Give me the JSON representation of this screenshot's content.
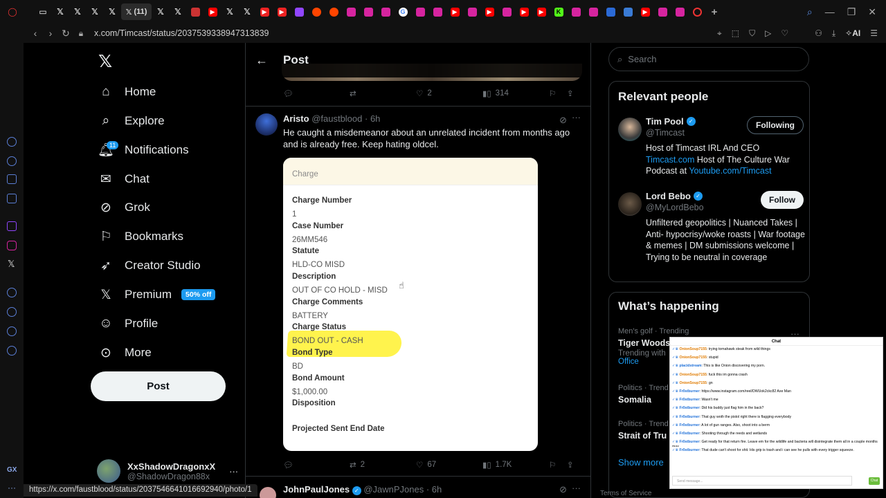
{
  "browser": {
    "active_tab_label": "(11)",
    "url": "x.com/Timcast/status/2037539338947313839",
    "ai_label": "AI",
    "status_link": "https://x.com/faustblood/status/2037546641016692940/photo/1"
  },
  "nav": {
    "items": [
      {
        "label": "Home",
        "icon": "home-icon"
      },
      {
        "label": "Explore",
        "icon": "search-icon"
      },
      {
        "label": "Notifications",
        "icon": "bell-icon",
        "badge": "11"
      },
      {
        "label": "Chat",
        "icon": "mail-icon"
      },
      {
        "label": "Grok",
        "icon": "grok-icon"
      },
      {
        "label": "Bookmarks",
        "icon": "bookmark-icon"
      },
      {
        "label": "Creator Studio",
        "icon": "rocket-icon"
      },
      {
        "label": "Premium",
        "icon": "x-logo-icon",
        "promo": "50% off"
      },
      {
        "label": "Profile",
        "icon": "person-icon"
      },
      {
        "label": "More",
        "icon": "more-circle-icon"
      }
    ],
    "post_button": "Post",
    "account": {
      "name": "XxShadowDragonxX",
      "handle": "@ShadowDragon88x",
      "more": "···"
    }
  },
  "header": {
    "title": "Post"
  },
  "prev_actions": {
    "replies": "",
    "reposts": "",
    "likes": "2",
    "views": "314"
  },
  "tweet": {
    "name": "Aristo",
    "handle": "@faustblood",
    "time": "· 6h",
    "text": "He caught a misdemeanor about an unrelated incident from months ago and is already free. Keep hating oldcel.",
    "card": {
      "header": "Charge",
      "rows": [
        {
          "k": "Charge Number",
          "v": "1"
        },
        {
          "k": "Case Number",
          "v": "26MM546"
        },
        {
          "k": "Statute",
          "v": "HLD-CO MISD"
        },
        {
          "k": "Description",
          "v": "OUT OF CO HOLD - MISD"
        },
        {
          "k": "Charge Comments",
          "v": "BATTERY"
        },
        {
          "k": "Charge Status",
          "v": "BOND OUT - CASH"
        },
        {
          "k": "Bond Type",
          "v": "BD"
        },
        {
          "k": "Bond Amount",
          "v": "$1,000.00"
        },
        {
          "k": "Disposition",
          "v": ""
        },
        {
          "k": "Projected Sent End Date",
          "v": ""
        }
      ]
    },
    "actions": {
      "replies": "",
      "reposts": "2",
      "likes": "67",
      "views": "1.7K"
    }
  },
  "next_tweet": {
    "name": "JohnPaulJones",
    "handle": "@JawnPJones",
    "time": "· 6h"
  },
  "search": {
    "placeholder": "Search"
  },
  "relevant": {
    "title": "Relevant people",
    "people": [
      {
        "name": "Tim Pool",
        "handle": "@Timcast",
        "button": "Following",
        "bio_a": "Host of Timcast IRL And CEO ",
        "bio_link1": "Timcast.com",
        "bio_b": " Host of The Culture War Podcast at ",
        "bio_link2": "Youtube.com/Timcast"
      },
      {
        "name": "Lord Bebo",
        "handle": "@MyLordBebo",
        "button": "Follow",
        "bio_a": "Unfiltered geopolitics | Nuanced Takes | Anti- hypocrisy/woke roasts | War footage & memes | DM submissions welcome | Trying to be neutral in coverage"
      }
    ]
  },
  "happening": {
    "title": "What’s happening",
    "trends": [
      {
        "cat": "Men's golf · Trending",
        "name": "Tiger Woods",
        "sub": "Trending with",
        "sub_link": "Office"
      },
      {
        "cat": "Politics · Trend",
        "name": "Somalia"
      },
      {
        "cat": "Politics · Trend",
        "name": "Strait of Tru"
      }
    ],
    "show_more": "Show more",
    "more": "···",
    "terms": "Terms of Service"
  },
  "chat": {
    "title": "Chat",
    "messages": [
      {
        "user": "OnionSoup7155",
        "text": ": trying tomahawk steak from wild things",
        "orange": true
      },
      {
        "user": "OnionSoup7155",
        "text": ": stupid",
        "orange": true
      },
      {
        "user": "placidstream",
        "text": ": This is like Onion discovering my porn.",
        "orange": false
      },
      {
        "user": "OnionSoup7155",
        "text": ": fuck this im gonna crash",
        "orange": true
      },
      {
        "user": "OnionSoup7155",
        "text": ": gn",
        "orange": true
      },
      {
        "user": "Fr0stburner",
        "text": ": https://www.instagram.com/reel/DWUok2ckc82 Axe Man",
        "orange": false
      },
      {
        "user": "Fr0stburner",
        "text": ": Wasn't me",
        "orange": false
      },
      {
        "user": "Fr0stburner",
        "text": ": Did his buddy just flag him in the back?",
        "orange": false
      },
      {
        "user": "Fr0stburner",
        "text": ": That guy woth the pistol right there is flagging everybody",
        "orange": false
      },
      {
        "user": "Fr0stburner",
        "text": ": A lot of gun ranges. Also, shoot into a berm",
        "orange": false
      },
      {
        "user": "Fr0stburner",
        "text": ": Shooting through the reeds and wetlands",
        "orange": false
      },
      {
        "user": "Fr0stburner",
        "text": ": Get ready for that return fire. Leave em for the wildlife and bacteria will disintegrate them all in a couple months max.",
        "orange": false
      },
      {
        "user": "Fr0stburner",
        "text": ": That dude can't shoot for shit. His grip is trash and i can see he pulls with every trigger squeeze.",
        "orange": false
      }
    ],
    "input_placeholder": "Send message...",
    "send": "Chat"
  }
}
